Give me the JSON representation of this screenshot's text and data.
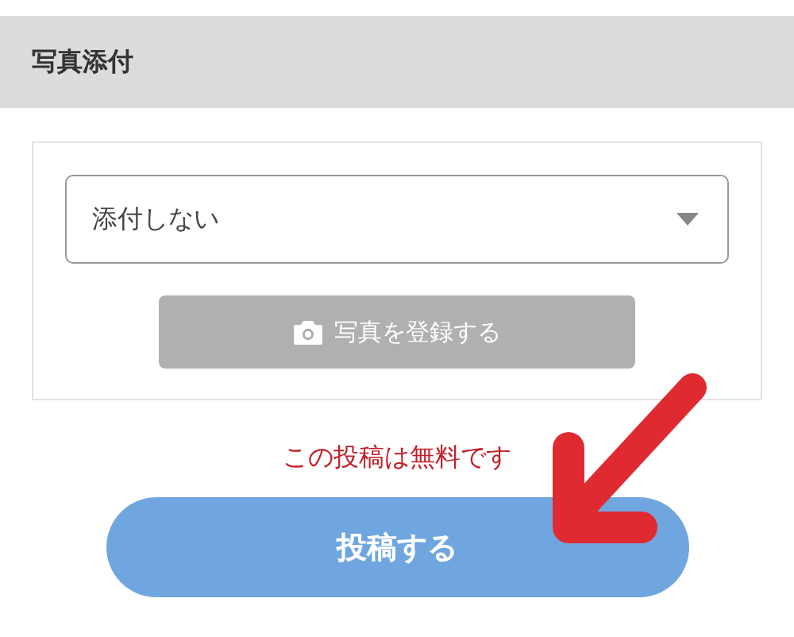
{
  "section": {
    "title": "写真添付"
  },
  "attachment_select": {
    "value": "添付しない"
  },
  "photo_button": {
    "label": "写真を登録する",
    "disabled": true
  },
  "notice": "この投稿は無料です",
  "submit_button": {
    "label": "投稿する"
  }
}
